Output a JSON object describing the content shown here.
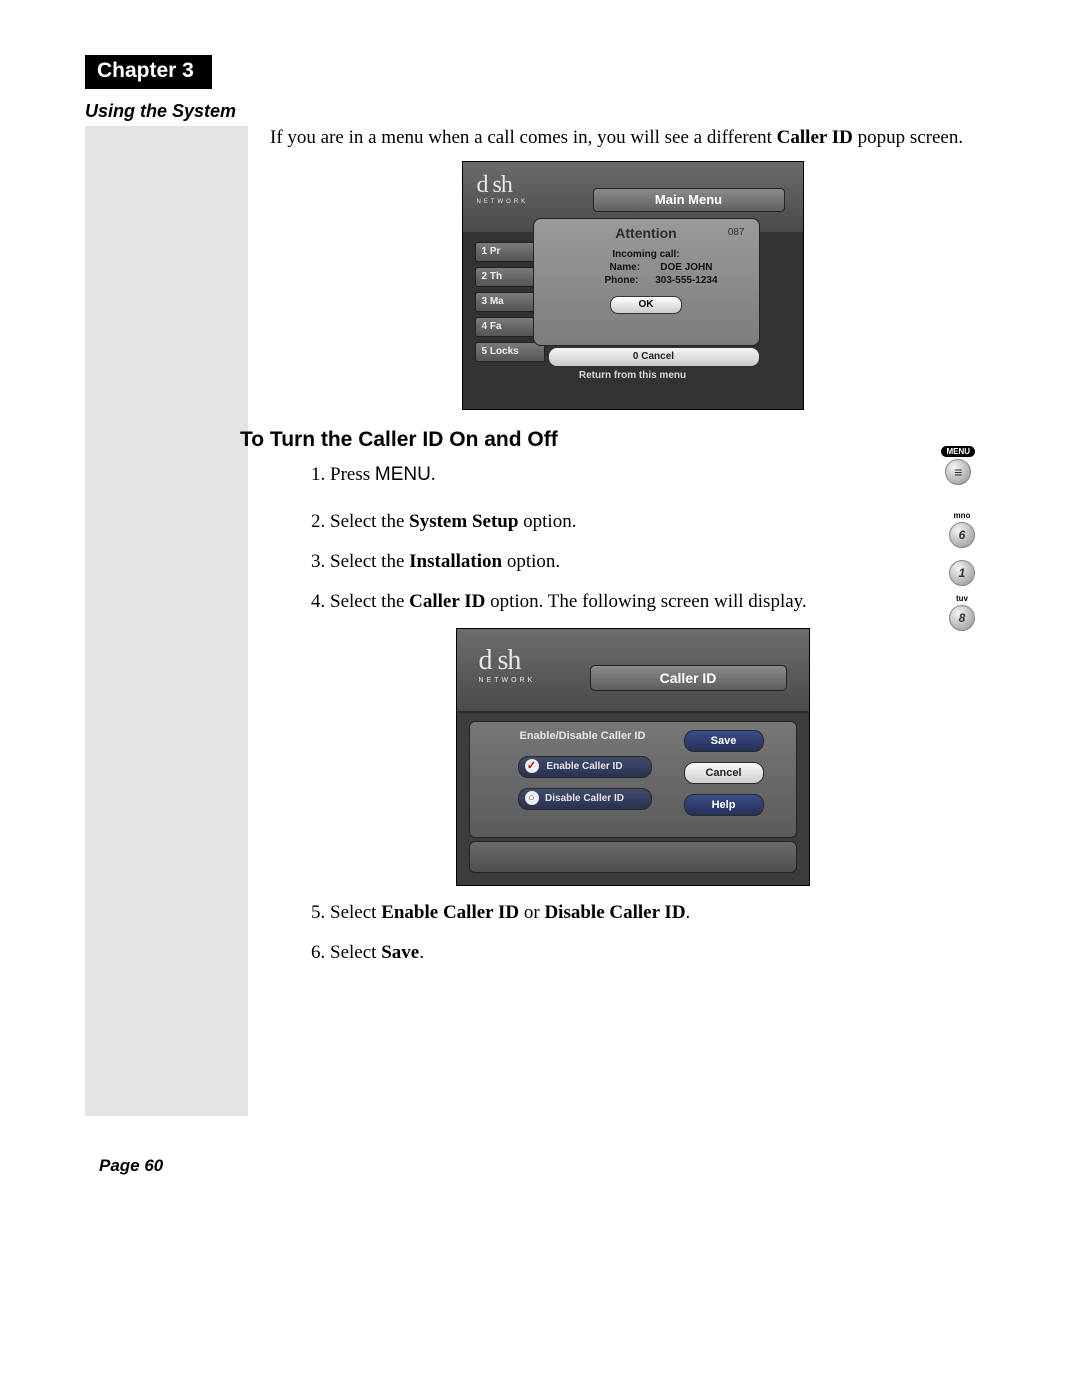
{
  "chapter": {
    "title": "Chapter 3",
    "subtitle": "Using the System"
  },
  "intro": {
    "pre": "If you are in a menu when a call comes in, you will see a different ",
    "bold": "Caller ID",
    "post": " popup screen."
  },
  "tvMenu1": {
    "brandTop": "d sh",
    "brandSub": "NETWORK",
    "title": "Main Menu",
    "popup": {
      "title": "Attention",
      "code": "087",
      "incoming": "Incoming call:",
      "nameLabel": "Name:",
      "nameValue": "DOE JOHN",
      "phoneLabel": "Phone:",
      "phoneValue": "303-555-1234",
      "ok": "OK"
    },
    "rows": [
      "1 Pr",
      "2 Th",
      "3 Ma",
      "4 Fa",
      "5 Locks"
    ],
    "cancel": "0 Cancel",
    "return": "Return from this menu"
  },
  "heading": "To Turn the Caller ID On and Off",
  "steps": {
    "s1pre": "Press ",
    "s1menu": "MENU",
    "s1post": ".",
    "s2pre": "Select the ",
    "s2bold": "System Setup",
    "s2post": " option.",
    "s3pre": "Select the ",
    "s3bold": "Installation",
    "s3post": " option.",
    "s4pre": "Select the ",
    "s4bold": "Caller ID",
    "s4post": " option. The following screen will display.",
    "s5pre": "Select ",
    "s5boldA": "Enable Caller ID",
    "s5mid": " or ",
    "s5boldB": "Disable Caller ID",
    "s5post": ".",
    "s6pre": "Select ",
    "s6bold": "Save",
    "s6post": "."
  },
  "tvMenu2": {
    "brandTop": "d sh",
    "brandSub": "NETWORK",
    "title": "Caller ID",
    "panelTitle": "Enable/Disable Caller ID",
    "optEnable": "Enable Caller ID",
    "optDisable": "Disable Caller ID",
    "save": "Save",
    "cancel": "Cancel",
    "help": "Help"
  },
  "remote": {
    "menuLabel": "MENU",
    "mnoLabel": "mno",
    "sixGlyph": "6",
    "oneGlyph": "1",
    "tuvLabel": "tuv",
    "eightGlyph": "8"
  },
  "pageNum": "Page 60"
}
